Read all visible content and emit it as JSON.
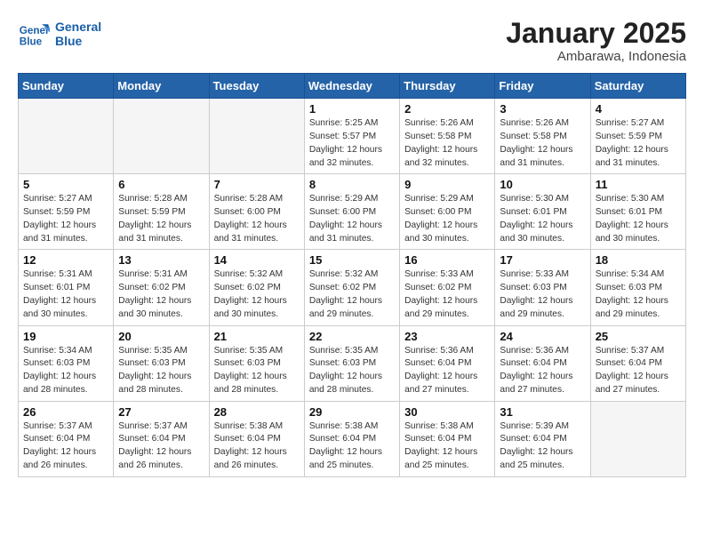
{
  "header": {
    "logo_line1": "General",
    "logo_line2": "Blue",
    "month_year": "January 2025",
    "location": "Ambarawa, Indonesia"
  },
  "weekdays": [
    "Sunday",
    "Monday",
    "Tuesday",
    "Wednesday",
    "Thursday",
    "Friday",
    "Saturday"
  ],
  "weeks": [
    [
      {
        "day": "",
        "info": ""
      },
      {
        "day": "",
        "info": ""
      },
      {
        "day": "",
        "info": ""
      },
      {
        "day": "1",
        "info": "Sunrise: 5:25 AM\nSunset: 5:57 PM\nDaylight: 12 hours\nand 32 minutes."
      },
      {
        "day": "2",
        "info": "Sunrise: 5:26 AM\nSunset: 5:58 PM\nDaylight: 12 hours\nand 32 minutes."
      },
      {
        "day": "3",
        "info": "Sunrise: 5:26 AM\nSunset: 5:58 PM\nDaylight: 12 hours\nand 31 minutes."
      },
      {
        "day": "4",
        "info": "Sunrise: 5:27 AM\nSunset: 5:59 PM\nDaylight: 12 hours\nand 31 minutes."
      }
    ],
    [
      {
        "day": "5",
        "info": "Sunrise: 5:27 AM\nSunset: 5:59 PM\nDaylight: 12 hours\nand 31 minutes."
      },
      {
        "day": "6",
        "info": "Sunrise: 5:28 AM\nSunset: 5:59 PM\nDaylight: 12 hours\nand 31 minutes."
      },
      {
        "day": "7",
        "info": "Sunrise: 5:28 AM\nSunset: 6:00 PM\nDaylight: 12 hours\nand 31 minutes."
      },
      {
        "day": "8",
        "info": "Sunrise: 5:29 AM\nSunset: 6:00 PM\nDaylight: 12 hours\nand 31 minutes."
      },
      {
        "day": "9",
        "info": "Sunrise: 5:29 AM\nSunset: 6:00 PM\nDaylight: 12 hours\nand 30 minutes."
      },
      {
        "day": "10",
        "info": "Sunrise: 5:30 AM\nSunset: 6:01 PM\nDaylight: 12 hours\nand 30 minutes."
      },
      {
        "day": "11",
        "info": "Sunrise: 5:30 AM\nSunset: 6:01 PM\nDaylight: 12 hours\nand 30 minutes."
      }
    ],
    [
      {
        "day": "12",
        "info": "Sunrise: 5:31 AM\nSunset: 6:01 PM\nDaylight: 12 hours\nand 30 minutes."
      },
      {
        "day": "13",
        "info": "Sunrise: 5:31 AM\nSunset: 6:02 PM\nDaylight: 12 hours\nand 30 minutes."
      },
      {
        "day": "14",
        "info": "Sunrise: 5:32 AM\nSunset: 6:02 PM\nDaylight: 12 hours\nand 30 minutes."
      },
      {
        "day": "15",
        "info": "Sunrise: 5:32 AM\nSunset: 6:02 PM\nDaylight: 12 hours\nand 29 minutes."
      },
      {
        "day": "16",
        "info": "Sunrise: 5:33 AM\nSunset: 6:02 PM\nDaylight: 12 hours\nand 29 minutes."
      },
      {
        "day": "17",
        "info": "Sunrise: 5:33 AM\nSunset: 6:03 PM\nDaylight: 12 hours\nand 29 minutes."
      },
      {
        "day": "18",
        "info": "Sunrise: 5:34 AM\nSunset: 6:03 PM\nDaylight: 12 hours\nand 29 minutes."
      }
    ],
    [
      {
        "day": "19",
        "info": "Sunrise: 5:34 AM\nSunset: 6:03 PM\nDaylight: 12 hours\nand 28 minutes."
      },
      {
        "day": "20",
        "info": "Sunrise: 5:35 AM\nSunset: 6:03 PM\nDaylight: 12 hours\nand 28 minutes."
      },
      {
        "day": "21",
        "info": "Sunrise: 5:35 AM\nSunset: 6:03 PM\nDaylight: 12 hours\nand 28 minutes."
      },
      {
        "day": "22",
        "info": "Sunrise: 5:35 AM\nSunset: 6:03 PM\nDaylight: 12 hours\nand 28 minutes."
      },
      {
        "day": "23",
        "info": "Sunrise: 5:36 AM\nSunset: 6:04 PM\nDaylight: 12 hours\nand 27 minutes."
      },
      {
        "day": "24",
        "info": "Sunrise: 5:36 AM\nSunset: 6:04 PM\nDaylight: 12 hours\nand 27 minutes."
      },
      {
        "day": "25",
        "info": "Sunrise: 5:37 AM\nSunset: 6:04 PM\nDaylight: 12 hours\nand 27 minutes."
      }
    ],
    [
      {
        "day": "26",
        "info": "Sunrise: 5:37 AM\nSunset: 6:04 PM\nDaylight: 12 hours\nand 26 minutes."
      },
      {
        "day": "27",
        "info": "Sunrise: 5:37 AM\nSunset: 6:04 PM\nDaylight: 12 hours\nand 26 minutes."
      },
      {
        "day": "28",
        "info": "Sunrise: 5:38 AM\nSunset: 6:04 PM\nDaylight: 12 hours\nand 26 minutes."
      },
      {
        "day": "29",
        "info": "Sunrise: 5:38 AM\nSunset: 6:04 PM\nDaylight: 12 hours\nand 25 minutes."
      },
      {
        "day": "30",
        "info": "Sunrise: 5:38 AM\nSunset: 6:04 PM\nDaylight: 12 hours\nand 25 minutes."
      },
      {
        "day": "31",
        "info": "Sunrise: 5:39 AM\nSunset: 6:04 PM\nDaylight: 12 hours\nand 25 minutes."
      },
      {
        "day": "",
        "info": ""
      }
    ]
  ]
}
